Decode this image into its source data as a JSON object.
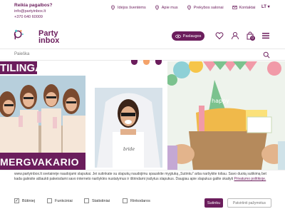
{
  "topbar": {
    "help_title": "Reikia pagalbos?",
    "email": "info@partyinbox.lt",
    "phone": "+370 640 60009",
    "links": [
      {
        "label": "Idėjos šventėms",
        "icon": "map-pin-icon"
      },
      {
        "label": "Apie mus",
        "icon": "map-pin-icon"
      },
      {
        "label": "Prekybos salonai",
        "icon": "map-pin-icon"
      },
      {
        "label": "Kontaktai",
        "icon": "mail-icon"
      }
    ],
    "language": "LT"
  },
  "header": {
    "logo_line1": "Party",
    "logo_line2": "inbox",
    "services_label": "Paslaugos",
    "cart_count": "0"
  },
  "search": {
    "placeholder": "Paieška"
  },
  "banner": {
    "headline_fragment": "TILINGA",
    "subline_fragment": "MERGVAKARIO",
    "dots": [
      "#6b1d5c",
      "#f4a36a",
      "#6b1d5c"
    ]
  },
  "cookie": {
    "text": "www.partyinbox.lt svetainėje naudojami slapukai. Jei sutinkate su slapukų naudojimu spauskite mygtuką „Sutinku\" arba naršykite toliau. Savo duotą sutikimą bet kada galėsite atšaukti pakeisdami savo interneto naršyklės nustatymus ir ištrindami įrašytus slapukus. Daugiau apie slapukus galite skaityti",
    "link_text": "Privatumo politikoje.",
    "options": [
      {
        "label": "Būtiniej",
        "checked": true
      },
      {
        "label": "Funkciniai",
        "checked": false
      },
      {
        "label": "Statistiniai",
        "checked": false
      },
      {
        "label": "Rinkodaros",
        "checked": false
      }
    ],
    "accept_label": "Sutinku",
    "confirm_label": "Patvirtinti pažymėtus"
  },
  "colors": {
    "brand": "#6b1d5c",
    "accent": "#f4a36a"
  }
}
